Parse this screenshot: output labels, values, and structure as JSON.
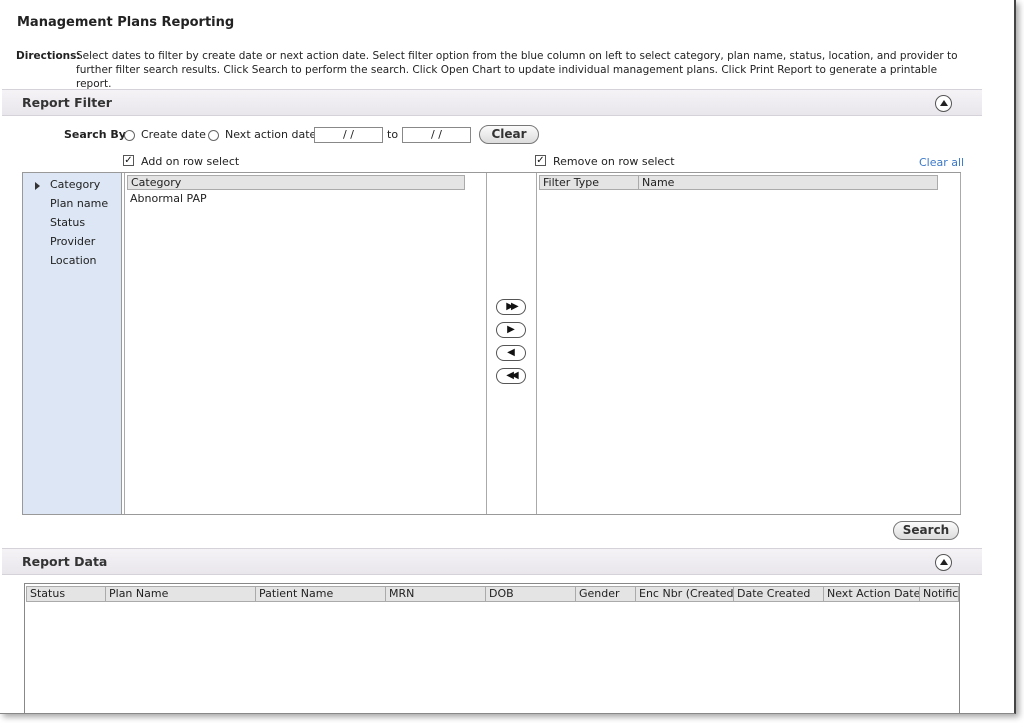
{
  "page": {
    "title": "Management Plans Reporting",
    "directions_label": "Directions:",
    "directions_text": "Select dates to filter by create date or next action date. Select filter option from the blue column on left to select category, plan name, status, location, and provider to further filter search results. Click Search to perform the search. Click Open Chart to update individual management plans. Click Print Report to generate a printable report."
  },
  "report_filter": {
    "title": "Report Filter",
    "search_by_label": "Search By:",
    "options": [
      "Create date",
      "Next action date"
    ],
    "date_from": "/ /",
    "to_label": "to",
    "date_to": "/ /",
    "clear_label": "Clear",
    "add_on_row_select": "Add on row select",
    "remove_on_row_select": "Remove on row select",
    "clear_all": "Clear all",
    "nav_items": [
      "Category",
      "Plan name",
      "Status",
      "Provider",
      "Location"
    ],
    "left_list": {
      "header": "Category",
      "rows": [
        "Abnormal PAP"
      ]
    },
    "right_list": {
      "headers": [
        "Filter Type",
        "Name"
      ]
    },
    "move_buttons": [
      "▶▶",
      "▶",
      "◀",
      "◀◀"
    ],
    "search_label": "Search"
  },
  "report_data": {
    "title": "Report Data",
    "columns": [
      "Status",
      "Plan Name",
      "Patient Name",
      "MRN",
      "DOB",
      "Gender",
      "Enc Nbr (Created)",
      "Date Created",
      "Next Action Date",
      "Notifica"
    ]
  }
}
